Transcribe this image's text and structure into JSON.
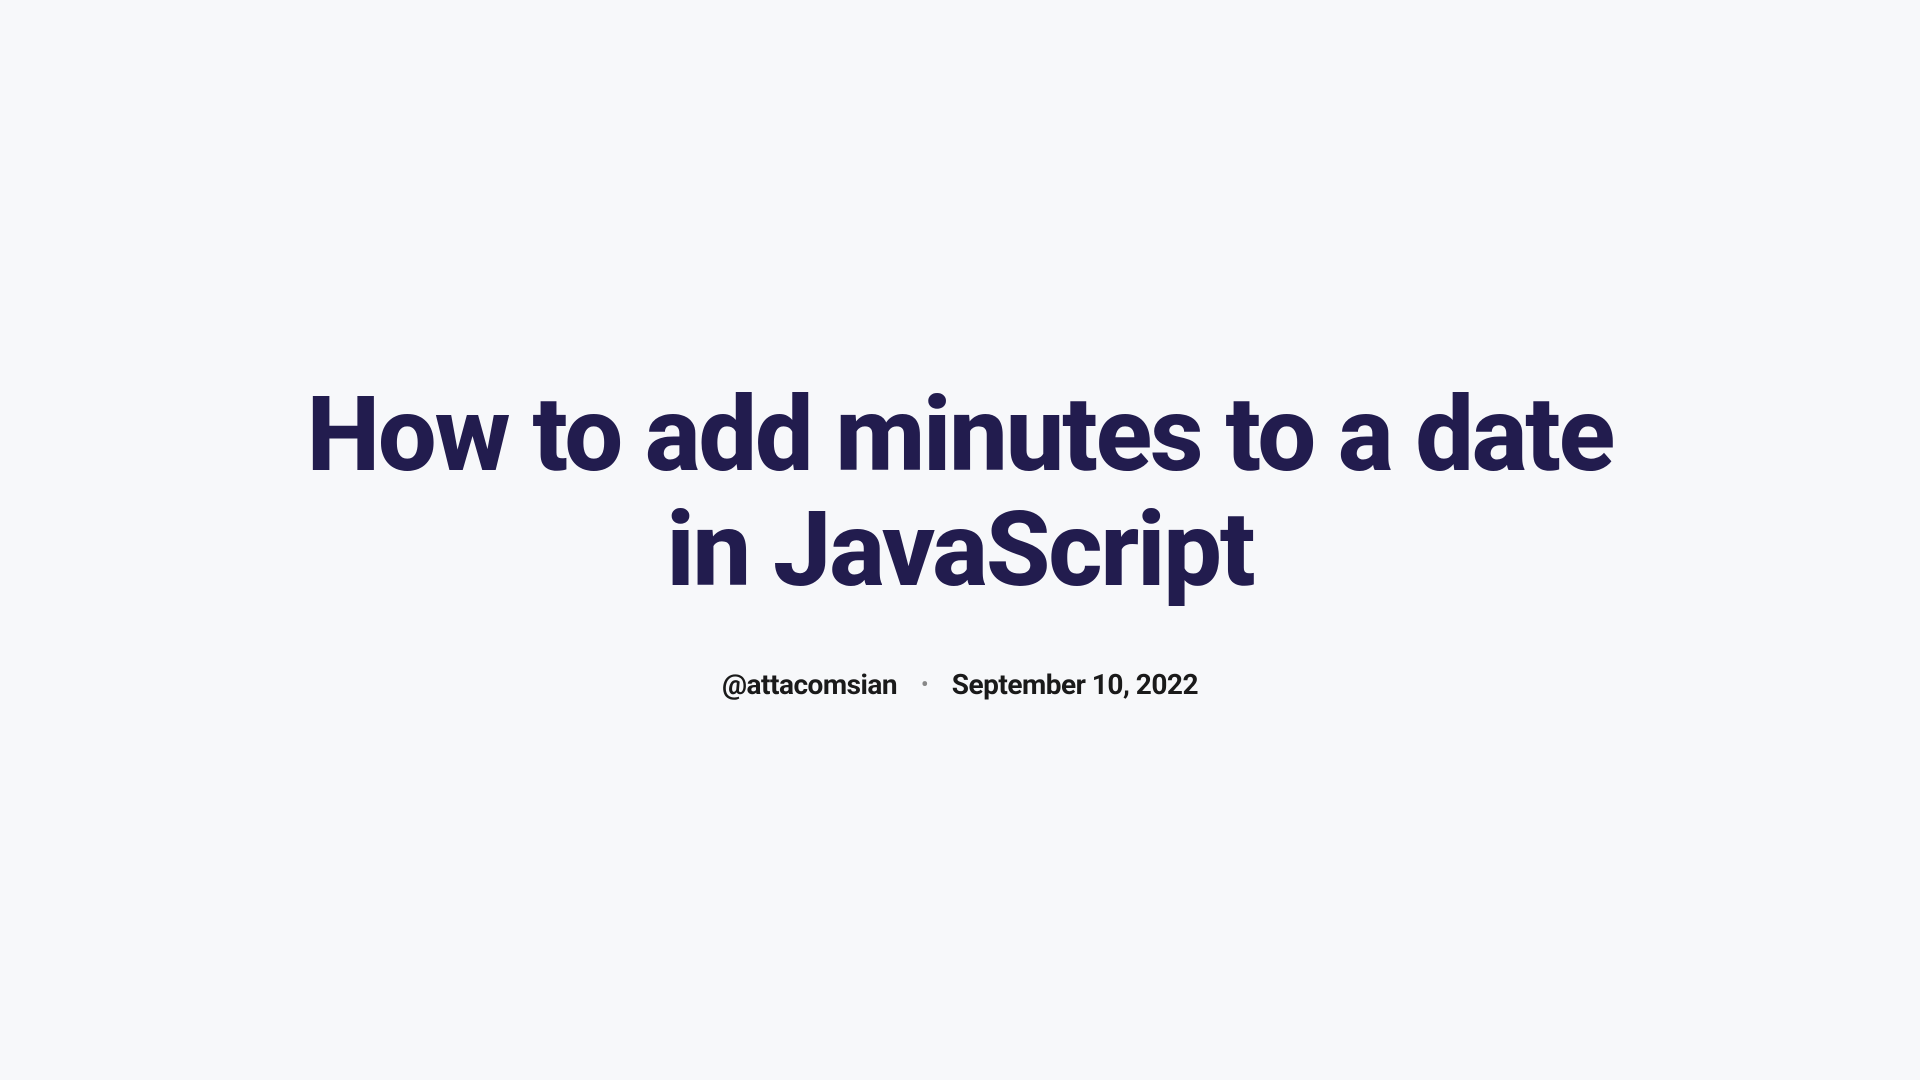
{
  "article": {
    "title": "How to add minutes to a date in JavaScript",
    "author_handle": "@attacomsian",
    "date": "September 10, 2022",
    "separator": "•"
  }
}
